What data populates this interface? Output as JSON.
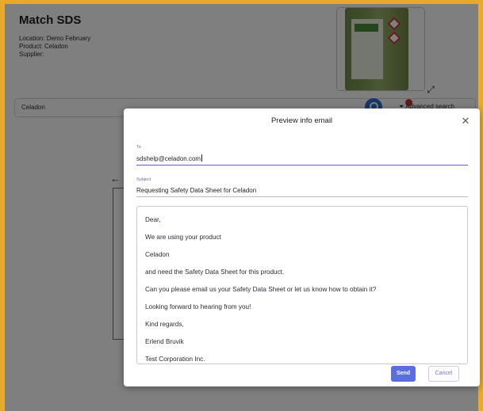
{
  "page": {
    "title": "Match SDS",
    "location": "Location: Demo February",
    "product": "Product: Celadon",
    "supplier": "Supplier:"
  },
  "search": {
    "value": "Celadon",
    "advanced_label": "Advanced search"
  },
  "icons": {
    "expand": "expand-icon",
    "search": "search-icon",
    "filter": "filter-icon",
    "back": "arrow-left-icon",
    "close": "close-icon"
  },
  "modal": {
    "title": "Preview info email",
    "to_label": "To",
    "to_value": "sdshelp@celadon.com",
    "subject_label": "Subject",
    "subject_value": "Requesting Safety Data Sheet for Celadon",
    "body_lines": [
      "Dear,",
      "We are using your product",
      "Celadon",
      "and need the Safety Data Sheet for this product.",
      "Can you please email us your Safety Data Sheet or let us know how to obtain it?",
      "Looking forward to hearing from you!",
      "Kind regards,",
      "Erlend Bruvik",
      "Test Corporation Inc."
    ],
    "send_label": "Send",
    "cancel_label": "Cancel"
  },
  "colors": {
    "frame": "#e9a92a",
    "primary": "#5b6ee0",
    "search_button": "#2f6fd6"
  }
}
